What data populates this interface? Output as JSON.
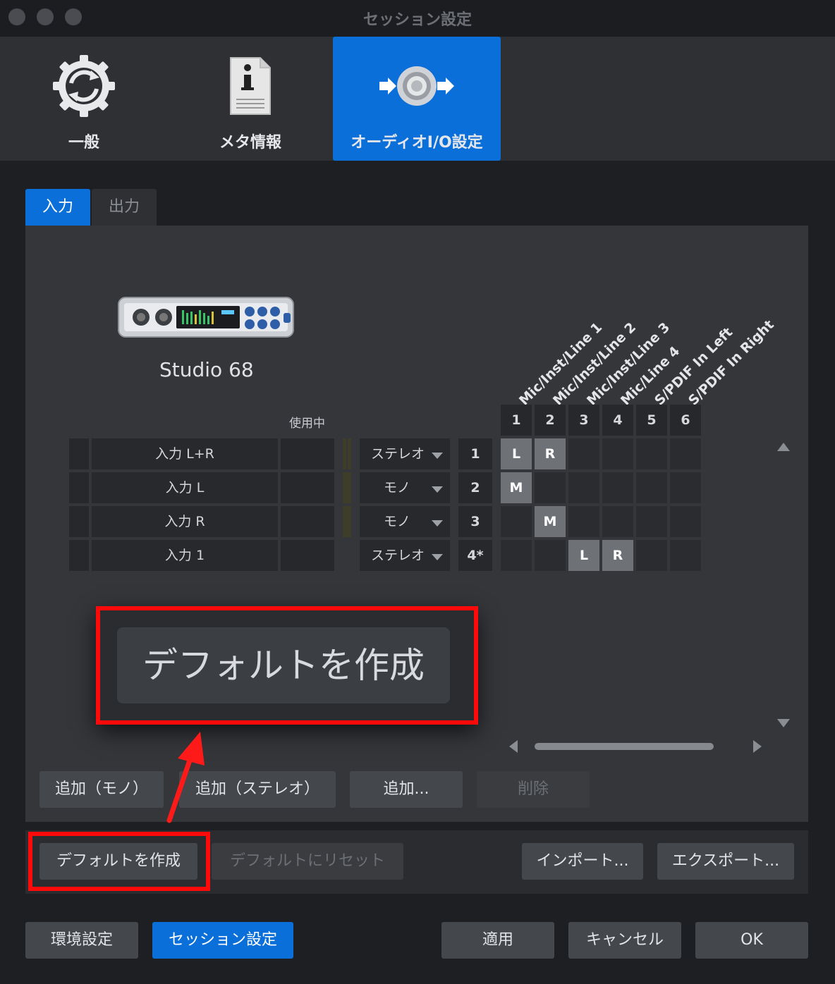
{
  "window": {
    "title": "セッション設定"
  },
  "icon_tabs": [
    {
      "label": "一般",
      "icon": "gear-sync-icon"
    },
    {
      "label": "メタ情報",
      "icon": "info-document-icon"
    },
    {
      "label": "オーディオI/O設定",
      "icon": "audio-io-icon"
    }
  ],
  "sub_tabs": {
    "input": "入力",
    "output": "出力"
  },
  "device": {
    "name": "Studio 68"
  },
  "inuse_label": "使用中",
  "channels": {
    "numbers": [
      "1",
      "2",
      "3",
      "4",
      "5",
      "6"
    ],
    "names": [
      "Mic/Inst/Line 1",
      "Mic/Inst/Line 2",
      "Mic/Inst/Line 3",
      "Mic/Line 4",
      "S/PDIF In Left",
      "S/PDIF In Right"
    ]
  },
  "rows": [
    {
      "name": "入力 L+R",
      "type": "ステレオ",
      "num": "1",
      "assign": {
        "0": "L",
        "1": "R"
      }
    },
    {
      "name": "入力 L",
      "type": "モノ",
      "num": "2",
      "assign": {
        "0": "M"
      }
    },
    {
      "name": "入力 R",
      "type": "モノ",
      "num": "3",
      "assign": {
        "1": "M"
      }
    },
    {
      "name": "入力 1",
      "type": "ステレオ",
      "num": "4*",
      "assign": {
        "2": "L",
        "3": "R"
      }
    }
  ],
  "buttons": {
    "add_mono": "追加（モノ）",
    "add_stereo": "追加（ステレオ）",
    "add": "追加...",
    "delete": "削除",
    "make_default": "デフォルトを作成",
    "reset_default": "デフォルトにリセット",
    "import": "インポート...",
    "export": "エクスポート...",
    "preferences": "環境設定",
    "session_settings": "セッション設定",
    "apply": "適用",
    "cancel": "キャンセル",
    "ok": "OK"
  },
  "callout": {
    "zoom_label": "デフォルトを作成"
  },
  "colors": {
    "accent": "#0a6fd9",
    "highlight": "#ff0a0a"
  }
}
